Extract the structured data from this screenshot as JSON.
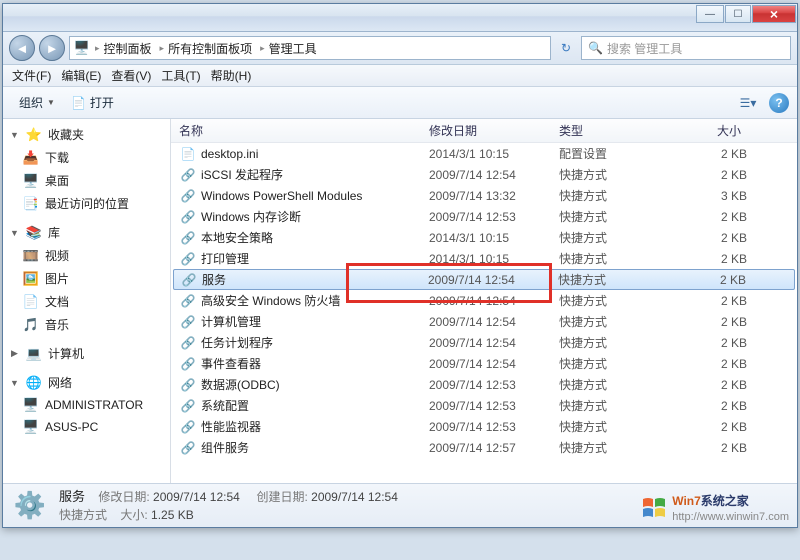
{
  "window": {
    "min": "—",
    "max": "☐",
    "close": "×"
  },
  "address": {
    "back": "◄",
    "fwd": "►",
    "crumbs": [
      "控制面板",
      "所有控制面板项",
      "管理工具"
    ],
    "refresh": "↻",
    "search_placeholder": "搜索 管理工具"
  },
  "menu": [
    "文件(F)",
    "编辑(E)",
    "查看(V)",
    "工具(T)",
    "帮助(H)"
  ],
  "toolbar": {
    "organize": "组织",
    "open": "打开",
    "help": "?"
  },
  "sidebar": {
    "favorites": {
      "label": "收藏夹",
      "items": [
        "下载",
        "桌面",
        "最近访问的位置"
      ]
    },
    "libraries": {
      "label": "库",
      "items": [
        "视频",
        "图片",
        "文档",
        "音乐"
      ]
    },
    "computer": {
      "label": "计算机"
    },
    "network": {
      "label": "网络",
      "items": [
        "ADMINISTRATOR",
        "ASUS-PC"
      ]
    }
  },
  "columns": {
    "name": "名称",
    "date": "修改日期",
    "type": "类型",
    "size": "大小"
  },
  "files": [
    {
      "name": "desktop.ini",
      "date": "2014/3/1 10:15",
      "type": "配置设置",
      "size": "2 KB",
      "icon": "ini"
    },
    {
      "name": "iSCSI 发起程序",
      "date": "2009/7/14 12:54",
      "type": "快捷方式",
      "size": "2 KB",
      "icon": "lnk"
    },
    {
      "name": "Windows PowerShell Modules",
      "date": "2009/7/14 13:32",
      "type": "快捷方式",
      "size": "3 KB",
      "icon": "lnk"
    },
    {
      "name": "Windows 内存诊断",
      "date": "2009/7/14 12:53",
      "type": "快捷方式",
      "size": "2 KB",
      "icon": "lnk"
    },
    {
      "name": "本地安全策略",
      "date": "2014/3/1 10:15",
      "type": "快捷方式",
      "size": "2 KB",
      "icon": "lnk"
    },
    {
      "name": "打印管理",
      "date": "2014/3/1 10:15",
      "type": "快捷方式",
      "size": "2 KB",
      "icon": "lnk"
    },
    {
      "name": "服务",
      "date": "2009/7/14 12:54",
      "type": "快捷方式",
      "size": "2 KB",
      "icon": "lnk",
      "selected": true
    },
    {
      "name": "高级安全 Windows 防火墙",
      "date": "2009/7/14 12:54",
      "type": "快捷方式",
      "size": "2 KB",
      "icon": "lnk"
    },
    {
      "name": "计算机管理",
      "date": "2009/7/14 12:54",
      "type": "快捷方式",
      "size": "2 KB",
      "icon": "lnk"
    },
    {
      "name": "任务计划程序",
      "date": "2009/7/14 12:54",
      "type": "快捷方式",
      "size": "2 KB",
      "icon": "lnk"
    },
    {
      "name": "事件查看器",
      "date": "2009/7/14 12:54",
      "type": "快捷方式",
      "size": "2 KB",
      "icon": "lnk"
    },
    {
      "name": "数据源(ODBC)",
      "date": "2009/7/14 12:53",
      "type": "快捷方式",
      "size": "2 KB",
      "icon": "lnk"
    },
    {
      "name": "系统配置",
      "date": "2009/7/14 12:53",
      "type": "快捷方式",
      "size": "2 KB",
      "icon": "lnk"
    },
    {
      "name": "性能监视器",
      "date": "2009/7/14 12:53",
      "type": "快捷方式",
      "size": "2 KB",
      "icon": "lnk"
    },
    {
      "name": "组件服务",
      "date": "2009/7/14 12:57",
      "type": "快捷方式",
      "size": "2 KB",
      "icon": "lnk"
    }
  ],
  "status": {
    "filename": "服务",
    "mod_label": "修改日期:",
    "mod_value": "2009/7/14 12:54",
    "create_label": "创建日期:",
    "create_value": "2009/7/14 12:54",
    "type_label": "快捷方式",
    "size_label": "大小:",
    "size_value": "1.25 KB"
  },
  "watermark": {
    "brand1": "Win7",
    "brand2": "系统之家",
    "url": "http://www.winwin7.com"
  }
}
